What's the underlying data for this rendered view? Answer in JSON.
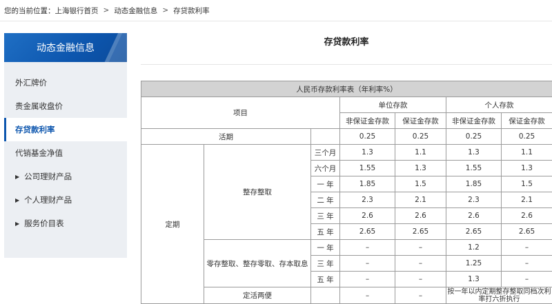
{
  "breadcrumb": {
    "prefix": "您的当前位置：",
    "items": [
      "上海银行首页",
      "动态金融信息",
      "存贷款利率"
    ],
    "separator": ">"
  },
  "sidebar": {
    "title": "动态金融信息",
    "items": [
      {
        "label": "外汇牌价",
        "expandable": false,
        "active": false
      },
      {
        "label": "贵金属收盘价",
        "expandable": false,
        "active": false
      },
      {
        "label": "存贷款利率",
        "expandable": false,
        "active": true
      },
      {
        "label": "代销基金净值",
        "expandable": false,
        "active": false
      },
      {
        "label": "公司理财产品",
        "expandable": true,
        "active": false
      },
      {
        "label": "个人理财产品",
        "expandable": true,
        "active": false
      },
      {
        "label": "服务价目表",
        "expandable": true,
        "active": false
      }
    ],
    "arrow_glyph": "▶"
  },
  "main": {
    "title": "存贷款利率"
  },
  "table": {
    "caption": "人民币存款利率表（年利率%）",
    "header": {
      "item": "项目",
      "unit_deposit": "单位存款",
      "personal_deposit": "个人存款",
      "non_guarantee": "非保证金存款",
      "guarantee": "保证金存款"
    },
    "current": {
      "label": "活期",
      "values": [
        "0.25",
        "0.25",
        "0.25",
        "0.25"
      ]
    },
    "fixed_label": "定期",
    "lump_sum": {
      "label": "整存整取",
      "rows": [
        {
          "term": "三个月",
          "values": [
            "1.3",
            "1.1",
            "1.3",
            "1.1"
          ]
        },
        {
          "term": "六个月",
          "values": [
            "1.55",
            "1.3",
            "1.55",
            "1.3"
          ]
        },
        {
          "term": "一 年",
          "values": [
            "1.85",
            "1.5",
            "1.85",
            "1.5"
          ]
        },
        {
          "term": "二 年",
          "values": [
            "2.3",
            "2.1",
            "2.3",
            "2.1"
          ]
        },
        {
          "term": "三 年",
          "values": [
            "2.6",
            "2.6",
            "2.6",
            "2.6"
          ]
        },
        {
          "term": "五 年",
          "values": [
            "2.65",
            "2.65",
            "2.65",
            "2.65"
          ]
        }
      ]
    },
    "installment": {
      "label": "零存整取、整存零取、存本取息",
      "rows": [
        {
          "term": "一 年",
          "values": [
            "–",
            "–",
            "1.2",
            "–"
          ]
        },
        {
          "term": "三 年",
          "values": [
            "–",
            "–",
            "1.25",
            "–"
          ]
        },
        {
          "term": "五 年",
          "values": [
            "–",
            "–",
            "1.3",
            "–"
          ]
        }
      ]
    },
    "flexible": {
      "label": "定活两便",
      "values": [
        "–",
        "–"
      ],
      "note": "按一年以内定期整存整取同档次利率打六折执行"
    }
  }
}
